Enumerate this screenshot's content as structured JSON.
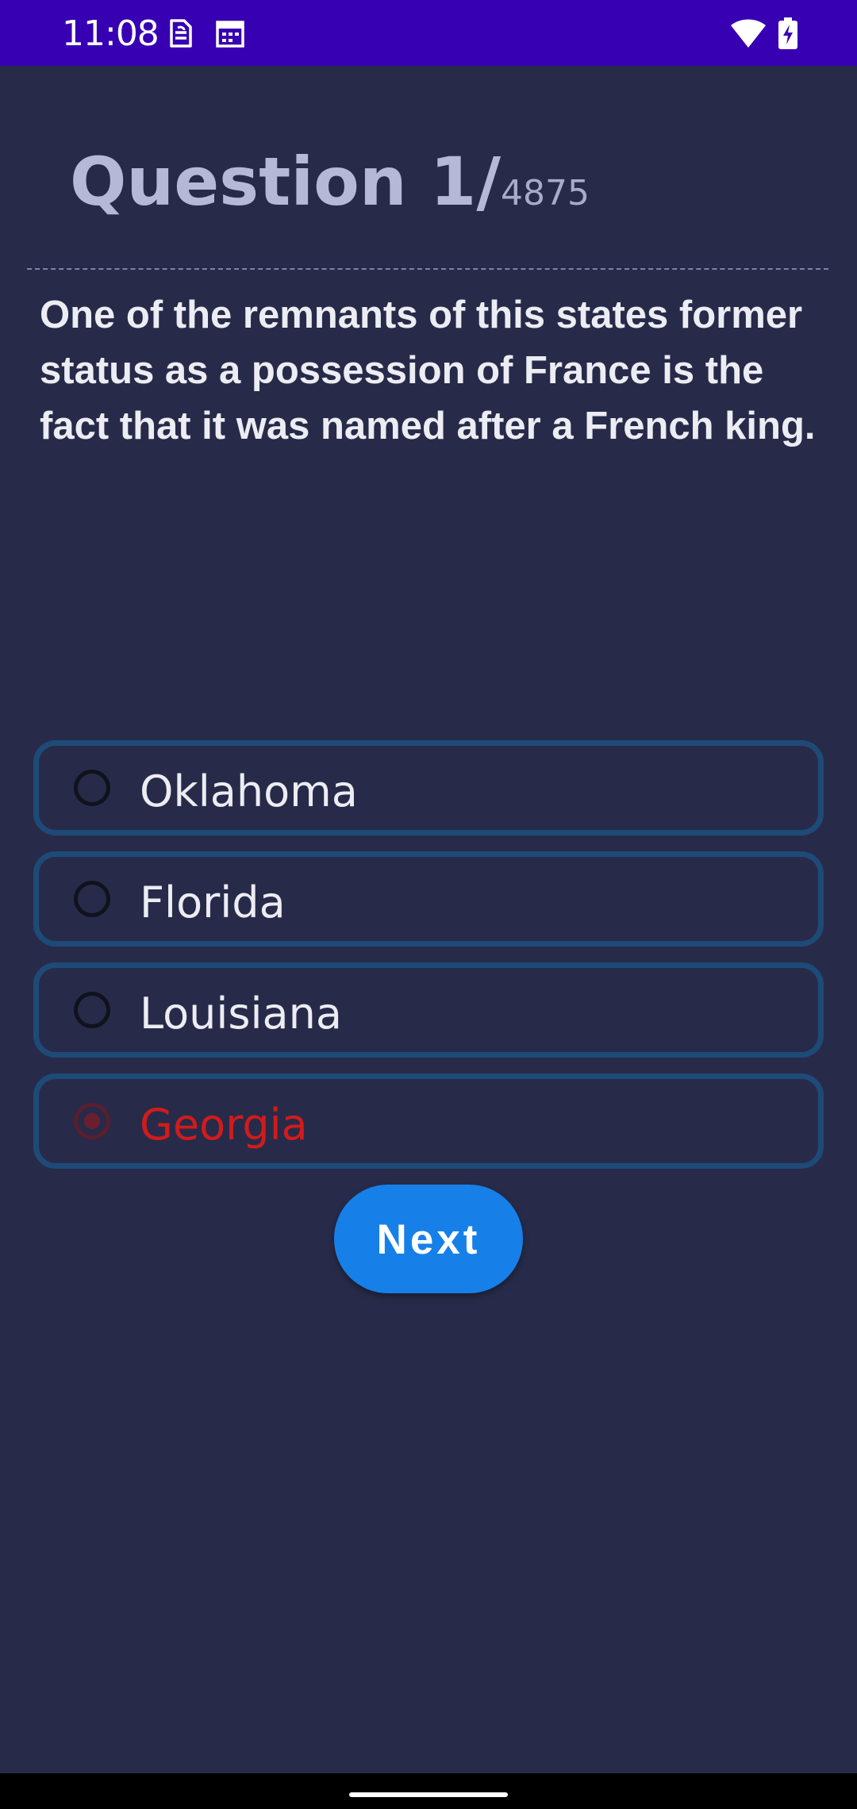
{
  "status_bar": {
    "time": "11:08",
    "icons": [
      "sim-card-icon",
      "calendar-icon",
      "wifi-icon",
      "battery-charging-icon"
    ]
  },
  "header": {
    "question_label": "Question 1/",
    "total": "4875"
  },
  "question": {
    "text": "One of the remnants of this states former status as a possession of France is the fact that it was named after a French king."
  },
  "options": [
    {
      "label": "Oklahoma",
      "selected": false
    },
    {
      "label": "Florida",
      "selected": false
    },
    {
      "label": "Louisiana",
      "selected": false
    },
    {
      "label": "Georgia",
      "selected": true
    }
  ],
  "next_button": {
    "label": "Next"
  },
  "colors": {
    "background": "#272b49",
    "status_bar": "#3700b3",
    "option_border": "#1e4a78",
    "wrong_answer": "#d11b1b",
    "button": "#1680e8"
  }
}
